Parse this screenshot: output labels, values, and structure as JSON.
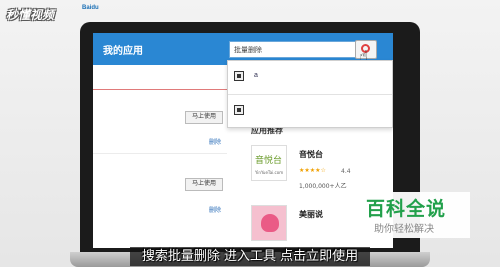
{
  "header": {
    "title": "我的应用",
    "search_value": "批量删除"
  },
  "dropdown": {
    "items": [
      {
        "label": "a"
      },
      {
        "label": ""
      }
    ]
  },
  "installed": {
    "items": [
      {
        "use_label": "马上使用",
        "delete_label": "删除"
      },
      {
        "use_label": "马上使用",
        "delete_label": "删除"
      }
    ]
  },
  "recommend": {
    "title": "应用推荐",
    "apps": [
      {
        "name": "音悦台",
        "logo_text": "音悦台",
        "logo_sub": "YinYueTai.com",
        "stars": "★★★★☆",
        "rating": "4.4",
        "users": "1,000,000+人乙"
      },
      {
        "name": "美丽说",
        "logo_text": "",
        "logo_sub": ""
      }
    ]
  },
  "overlays": {
    "watermark": "秒懂视频",
    "watermark_logo": "Baidu",
    "brand_title": "百科全说",
    "brand_sub": "助你轻松解决",
    "subtitle": "搜索批量删除 进入工具 点击立即使用"
  },
  "colors": {
    "header_blue": "#2a87d3",
    "brand_green": "#22a04b",
    "star_orange": "#f0a000"
  }
}
